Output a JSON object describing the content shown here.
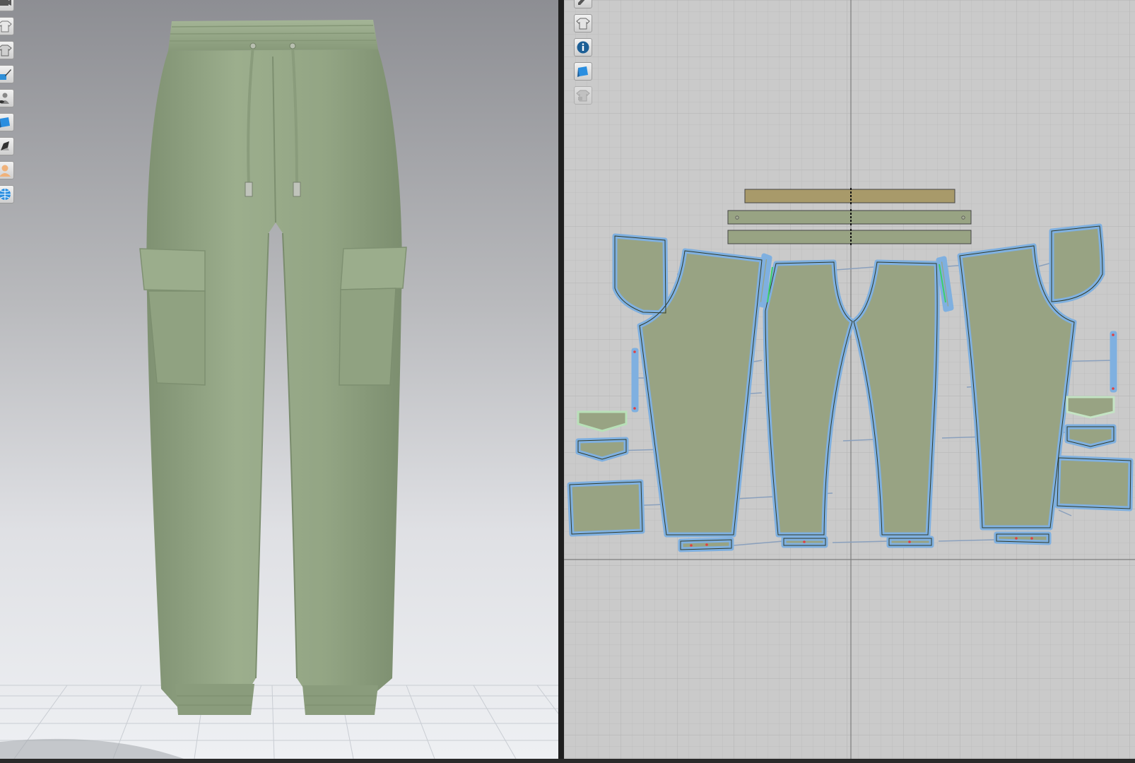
{
  "window": {
    "panes": [
      "3d-garment-view",
      "2d-pattern-view"
    ]
  },
  "toolbar_3d": {
    "tools": [
      {
        "icon": "camera-icon",
        "name": "display-camera-tool"
      },
      {
        "icon": "shirt-outline-icon",
        "name": "garment-outline-tool"
      },
      {
        "icon": "shirt-icon",
        "name": "show-garment-tool"
      },
      {
        "icon": "brush-icon",
        "name": "texture-brush-tool"
      },
      {
        "icon": "avatar-eye-icon",
        "name": "show-avatar-tool"
      },
      {
        "icon": "fabric-icon",
        "name": "fabric-display-tool"
      },
      {
        "icon": "arrangement-icon",
        "name": "arrangement-tool"
      },
      {
        "icon": "avatar-icon",
        "name": "avatar-tool"
      },
      {
        "icon": "globe-icon",
        "name": "environment-tool"
      }
    ]
  },
  "toolbar_2d": {
    "tools": [
      {
        "icon": "pen-icon",
        "name": "pattern-pen-tool"
      },
      {
        "icon": "shirt-icon",
        "name": "show-pattern-tool"
      },
      {
        "icon": "info-icon",
        "name": "pattern-info-tool"
      },
      {
        "icon": "fabric-icon",
        "name": "fabric-texture-tool"
      },
      {
        "icon": "lock-shirt-icon",
        "name": "lock-pattern-tool",
        "disabled": true
      }
    ]
  },
  "colors": {
    "garment": "#93a585",
    "pattern_fill": "#98a383",
    "pattern_selected_outline": "#7fb0e0",
    "waistband_fill": "#a89a6a",
    "view2d_background": "#cacaca",
    "divider": "#1f1f1f"
  }
}
